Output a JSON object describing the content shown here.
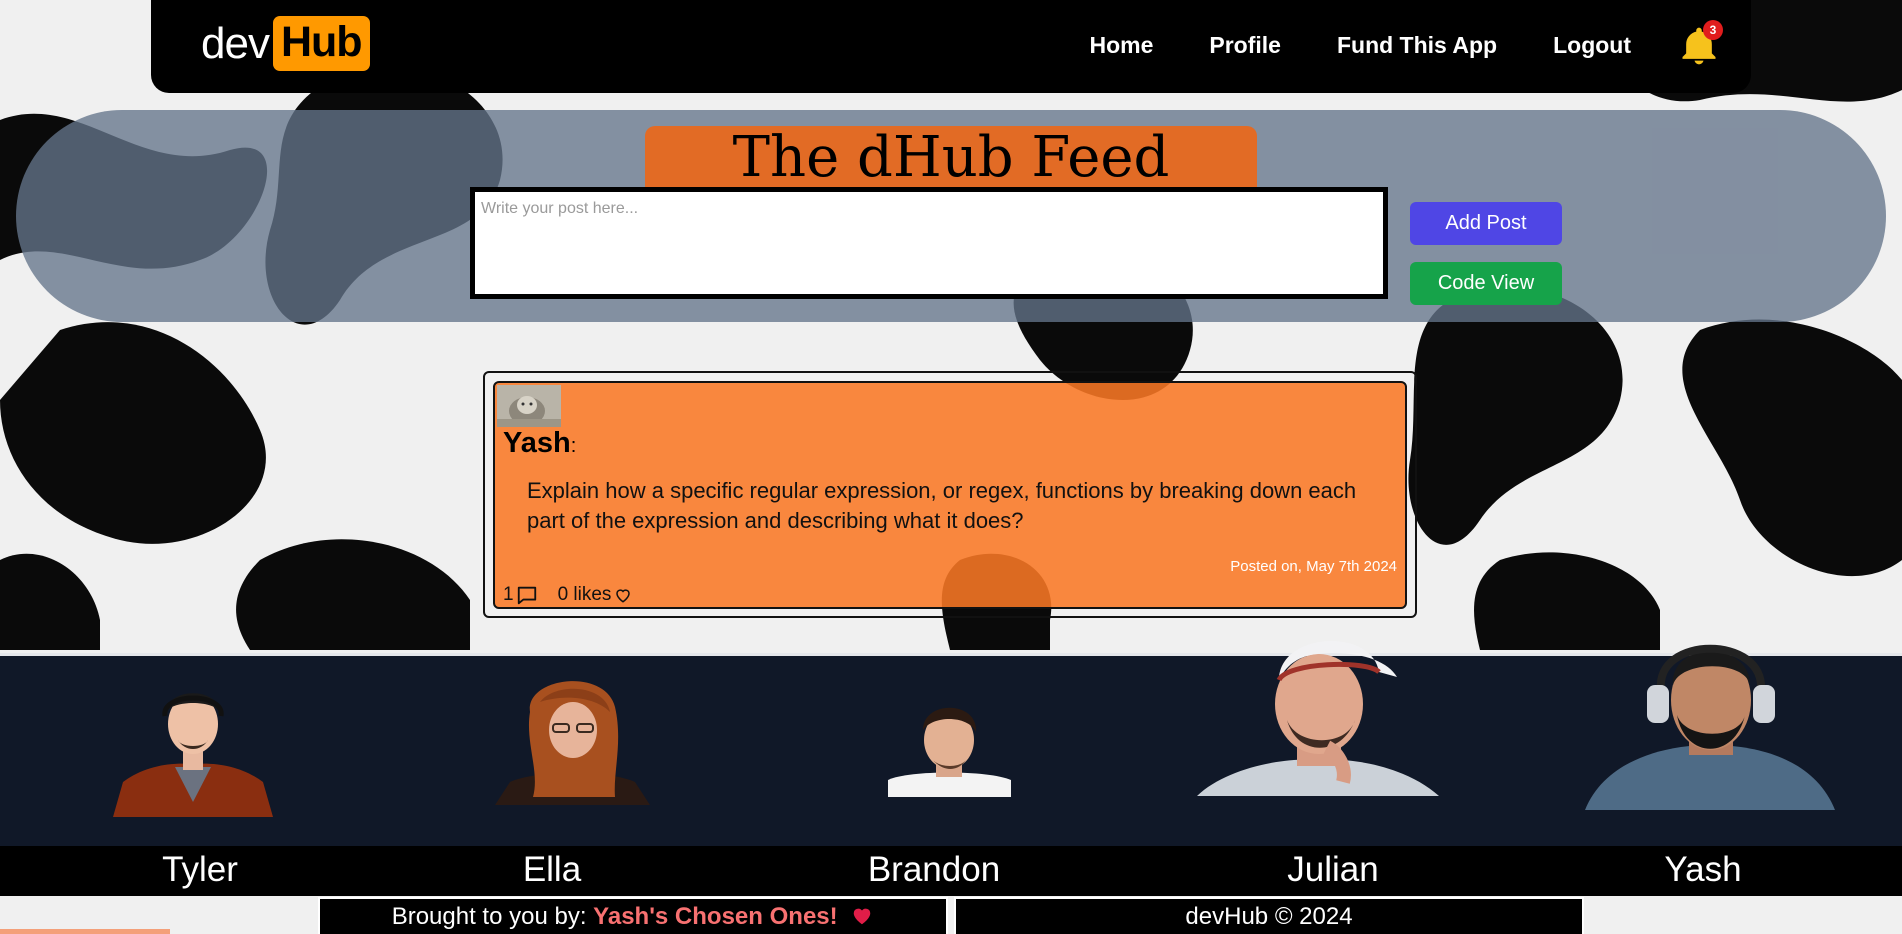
{
  "navbar": {
    "logo_dev": "dev",
    "logo_hub": "Hub",
    "links": [
      "Home",
      "Profile",
      "Fund This App",
      "Logout"
    ],
    "notification_count": "3"
  },
  "feed": {
    "title": "The dHub Feed",
    "input_placeholder": "Write your post here...",
    "add_post_label": "Add Post",
    "code_view_label": "Code View"
  },
  "post": {
    "author": "Yash",
    "author_suffix": ":",
    "text": "Explain how a specific regular expression, or regex, functions by breaking down each part of the expression and describing what it does?",
    "posted_on": "Posted on, May 7th 2024",
    "comment_count": "1",
    "likes_label": "0 likes"
  },
  "team": {
    "members": [
      "Tyler",
      "Ella",
      "Brandon",
      "Julian",
      "Yash"
    ]
  },
  "footer": {
    "brought_prefix": "Brought to you by: ",
    "brought_crew": "Yash's Chosen Ones!",
    "copyright": "devHub © 2024"
  },
  "colors": {
    "accent_orange": "#ff9900",
    "post_orange": "#f97824",
    "add_post": "#4f46e5",
    "code_view": "#16a34a",
    "team_band": "#101828",
    "badge_red": "#e11d1d"
  },
  "icons": [
    "bell-icon",
    "comment-icon",
    "heart-icon",
    "heart-filled-icon"
  ]
}
